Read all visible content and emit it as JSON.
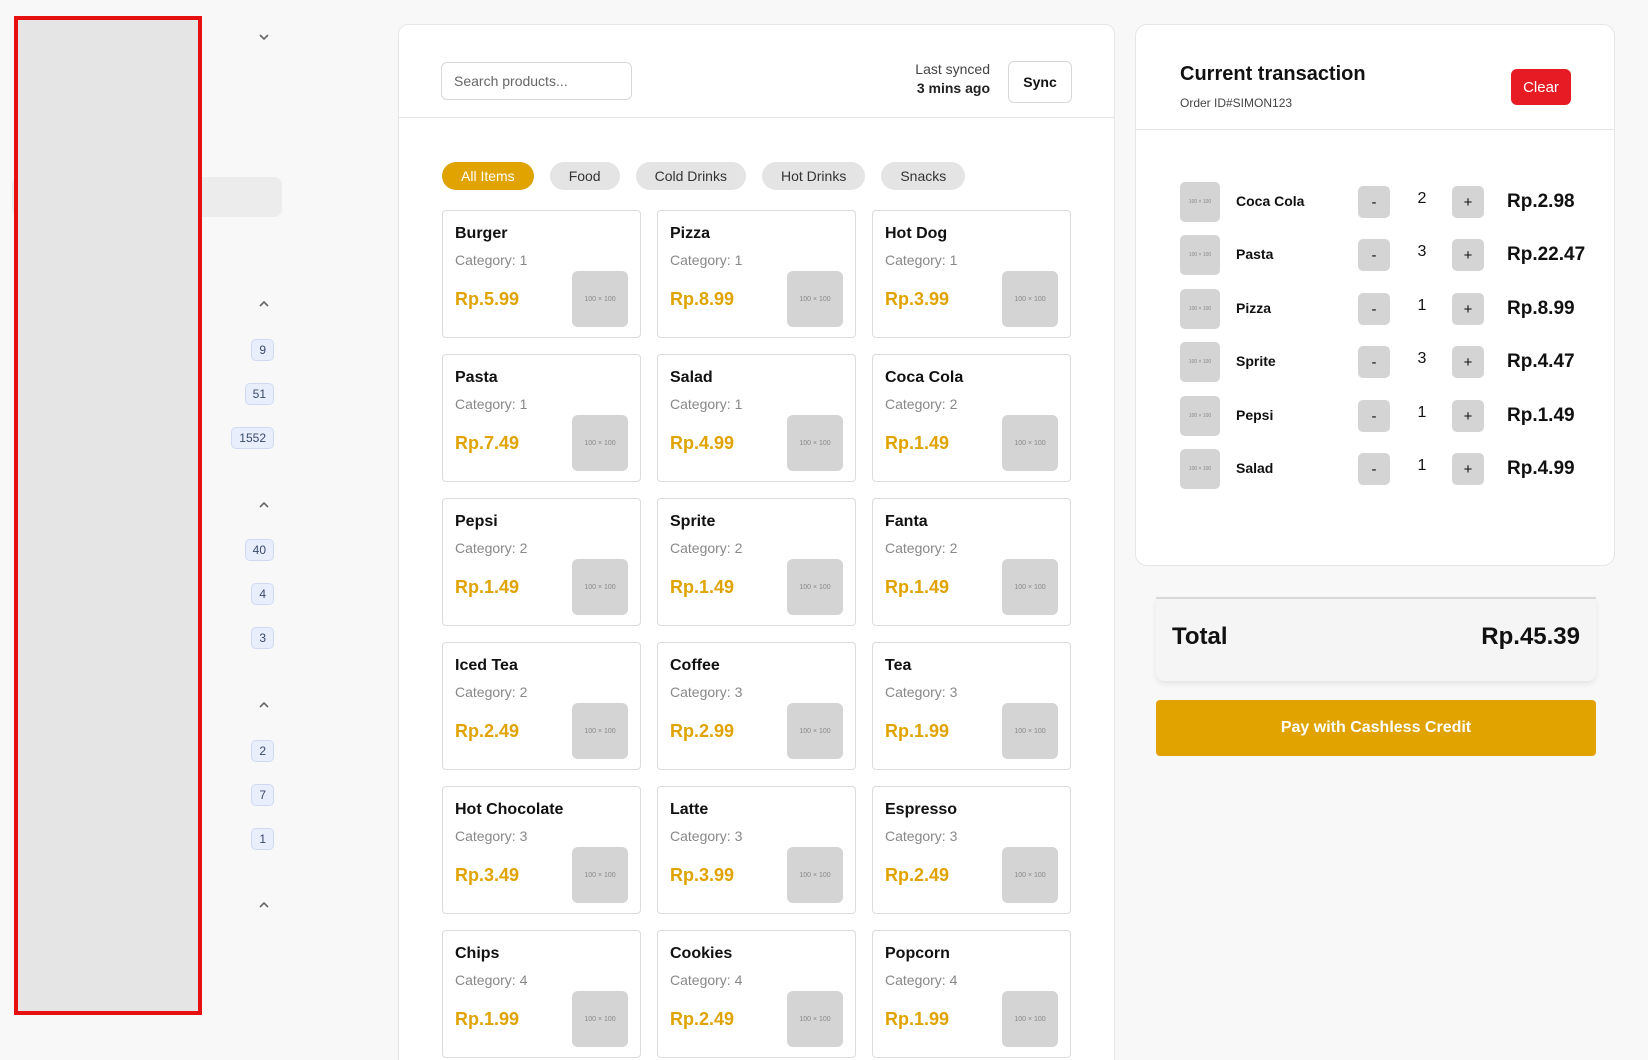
{
  "sidebar": {
    "badges": [
      "9",
      "51",
      "1552",
      "40",
      "4",
      "3",
      "2",
      "7",
      "1"
    ]
  },
  "header": {
    "search_placeholder": "Search products...",
    "last_synced_label": "Last synced",
    "last_synced_time": "3 mins ago",
    "sync_label": "Sync"
  },
  "categories": [
    {
      "label": "All Items",
      "active": true
    },
    {
      "label": "Food",
      "active": false
    },
    {
      "label": "Cold Drinks",
      "active": false
    },
    {
      "label": "Hot Drinks",
      "active": false
    },
    {
      "label": "Snacks",
      "active": false
    }
  ],
  "thumb_label": "100 × 100",
  "products": [
    {
      "name": "Burger",
      "category": "Category: 1",
      "price": "Rp.5.99"
    },
    {
      "name": "Pizza",
      "category": "Category: 1",
      "price": "Rp.8.99"
    },
    {
      "name": "Hot Dog",
      "category": "Category: 1",
      "price": "Rp.3.99"
    },
    {
      "name": "Pasta",
      "category": "Category: 1",
      "price": "Rp.7.49"
    },
    {
      "name": "Salad",
      "category": "Category: 1",
      "price": "Rp.4.99"
    },
    {
      "name": "Coca Cola",
      "category": "Category: 2",
      "price": "Rp.1.49"
    },
    {
      "name": "Pepsi",
      "category": "Category: 2",
      "price": "Rp.1.49"
    },
    {
      "name": "Sprite",
      "category": "Category: 2",
      "price": "Rp.1.49"
    },
    {
      "name": "Fanta",
      "category": "Category: 2",
      "price": "Rp.1.49"
    },
    {
      "name": "Iced Tea",
      "category": "Category: 2",
      "price": "Rp.2.49"
    },
    {
      "name": "Coffee",
      "category": "Category: 3",
      "price": "Rp.2.99"
    },
    {
      "name": "Tea",
      "category": "Category: 3",
      "price": "Rp.1.99"
    },
    {
      "name": "Hot Chocolate",
      "category": "Category: 3",
      "price": "Rp.3.49"
    },
    {
      "name": "Latte",
      "category": "Category: 3",
      "price": "Rp.3.99"
    },
    {
      "name": "Espresso",
      "category": "Category: 3",
      "price": "Rp.2.49"
    },
    {
      "name": "Chips",
      "category": "Category: 4",
      "price": "Rp.1.99"
    },
    {
      "name": "Cookies",
      "category": "Category: 4",
      "price": "Rp.2.49"
    },
    {
      "name": "Popcorn",
      "category": "Category: 4",
      "price": "Rp.1.99"
    }
  ],
  "transaction": {
    "title": "Current transaction",
    "order_id": "Order ID#SIMON123",
    "clear_label": "Clear",
    "minus_label": "-",
    "plus_label": "+",
    "items": [
      {
        "name": "Coca Cola",
        "qty": "2",
        "price": "Rp.2.98"
      },
      {
        "name": "Pasta",
        "qty": "3",
        "price": "Rp.22.47"
      },
      {
        "name": "Pizza",
        "qty": "1",
        "price": "Rp.8.99"
      },
      {
        "name": "Sprite",
        "qty": "3",
        "price": "Rp.4.47"
      },
      {
        "name": "Pepsi",
        "qty": "1",
        "price": "Rp.1.49"
      },
      {
        "name": "Salad",
        "qty": "1",
        "price": "Rp.4.99"
      }
    ],
    "total_label": "Total",
    "total_value": "Rp.45.39",
    "pay_label": "Pay with Cashless Credit"
  },
  "colors": {
    "accent": "#e0a300",
    "danger": "#e61b24",
    "redaction_border": "#e61010"
  }
}
